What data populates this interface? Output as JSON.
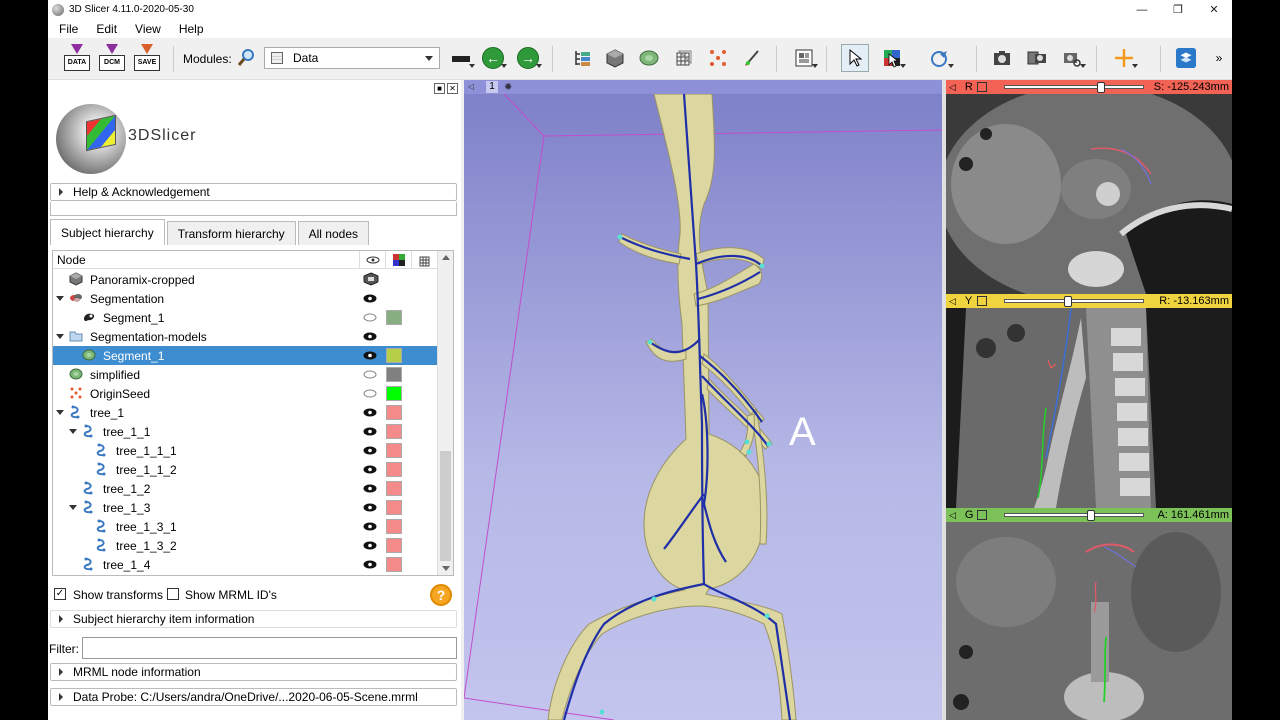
{
  "window": {
    "title": "3D Slicer 4.11.0-2020-05-30",
    "minimize": "—",
    "maximize": "❐",
    "close": "✕"
  },
  "menu": [
    "File",
    "Edit",
    "View",
    "Help"
  ],
  "toolbar": {
    "data_label": "DATA",
    "dcm_label": "DCM",
    "save_label": "SAVE",
    "modules_label": "Modules:",
    "module_selected": "Data",
    "more": "»"
  },
  "panel": {
    "logo_text": "3DSlicer",
    "help_section": "Help & Acknowledgement",
    "tabs": [
      "Subject hierarchy",
      "Transform hierarchy",
      "All nodes"
    ],
    "tree_header": "Node",
    "rows": [
      {
        "label": "Panoramix-cropped",
        "level": 0,
        "expand": "",
        "icon": "volume",
        "eye": "none",
        "color": ""
      },
      {
        "label": "Segmentation",
        "level": 0,
        "expand": "open",
        "icon": "segmentation",
        "eye": "shown",
        "color": ""
      },
      {
        "label": "Segment_1",
        "level": 1,
        "expand": "",
        "icon": "segment",
        "eye": "hidden",
        "color": "#87ae80"
      },
      {
        "label": "Segmentation-models",
        "level": 0,
        "expand": "open",
        "icon": "folder",
        "eye": "shown",
        "color": ""
      },
      {
        "label": "Segment_1",
        "level": 1,
        "expand": "",
        "icon": "model",
        "eye": "shown",
        "color": "#b5cf49",
        "selected": true
      },
      {
        "label": "simplified",
        "level": 0,
        "expand": "",
        "icon": "model",
        "eye": "hidden",
        "color": "#808080"
      },
      {
        "label": "OriginSeed",
        "level": 0,
        "expand": "",
        "icon": "seed",
        "eye": "hidden",
        "color": "#00ff00"
      },
      {
        "label": "tree_1",
        "level": 0,
        "expand": "open",
        "icon": "tree",
        "eye": "shown",
        "color": "#f58a8a"
      },
      {
        "label": "tree_1_1",
        "level": 1,
        "expand": "open",
        "icon": "tree",
        "eye": "shown",
        "color": "#f58a8a"
      },
      {
        "label": "tree_1_1_1",
        "level": 2,
        "expand": "",
        "icon": "tree",
        "eye": "shown",
        "color": "#f58a8a"
      },
      {
        "label": "tree_1_1_2",
        "level": 2,
        "expand": "",
        "icon": "tree",
        "eye": "shown",
        "color": "#f58a8a"
      },
      {
        "label": "tree_1_2",
        "level": 1,
        "expand": "",
        "icon": "tree",
        "eye": "shown",
        "color": "#f58a8a"
      },
      {
        "label": "tree_1_3",
        "level": 1,
        "expand": "open",
        "icon": "tree",
        "eye": "shown",
        "color": "#f58a8a"
      },
      {
        "label": "tree_1_3_1",
        "level": 2,
        "expand": "",
        "icon": "tree",
        "eye": "shown",
        "color": "#f58a8a"
      },
      {
        "label": "tree_1_3_2",
        "level": 2,
        "expand": "",
        "icon": "tree",
        "eye": "shown",
        "color": "#f58a8a"
      },
      {
        "label": "tree_1_4",
        "level": 1,
        "expand": "",
        "icon": "tree",
        "eye": "shown",
        "color": "#f58a8a"
      }
    ],
    "show_transforms": "Show transforms",
    "show_transforms_checked": true,
    "show_mrml_ids": "Show MRML ID's",
    "show_mrml_ids_checked": false,
    "check_mark": "✓",
    "help_glyph": "?",
    "item_info": "Subject hierarchy item information",
    "filter_label": "Filter:",
    "filter_value": "",
    "mrml_info": "MRML node information",
    "data_probe": "Data Probe: C:/Users/andra/OneDrive/...2020-06-05-Scene.mrml"
  },
  "view3d": {
    "number": "1",
    "annotation": "A"
  },
  "slices": [
    {
      "axis": "R",
      "offset": "S: -125.243mm",
      "bar_color": "#f26255",
      "slider_fraction": 0.7
    },
    {
      "axis": "Y",
      "offset": "R: -13.163mm",
      "bar_color": "#efd43f",
      "slider_fraction": 0.45
    },
    {
      "axis": "G",
      "offset": "A: 161.461mm",
      "bar_color": "#7dc159",
      "slider_fraction": 0.62
    }
  ]
}
